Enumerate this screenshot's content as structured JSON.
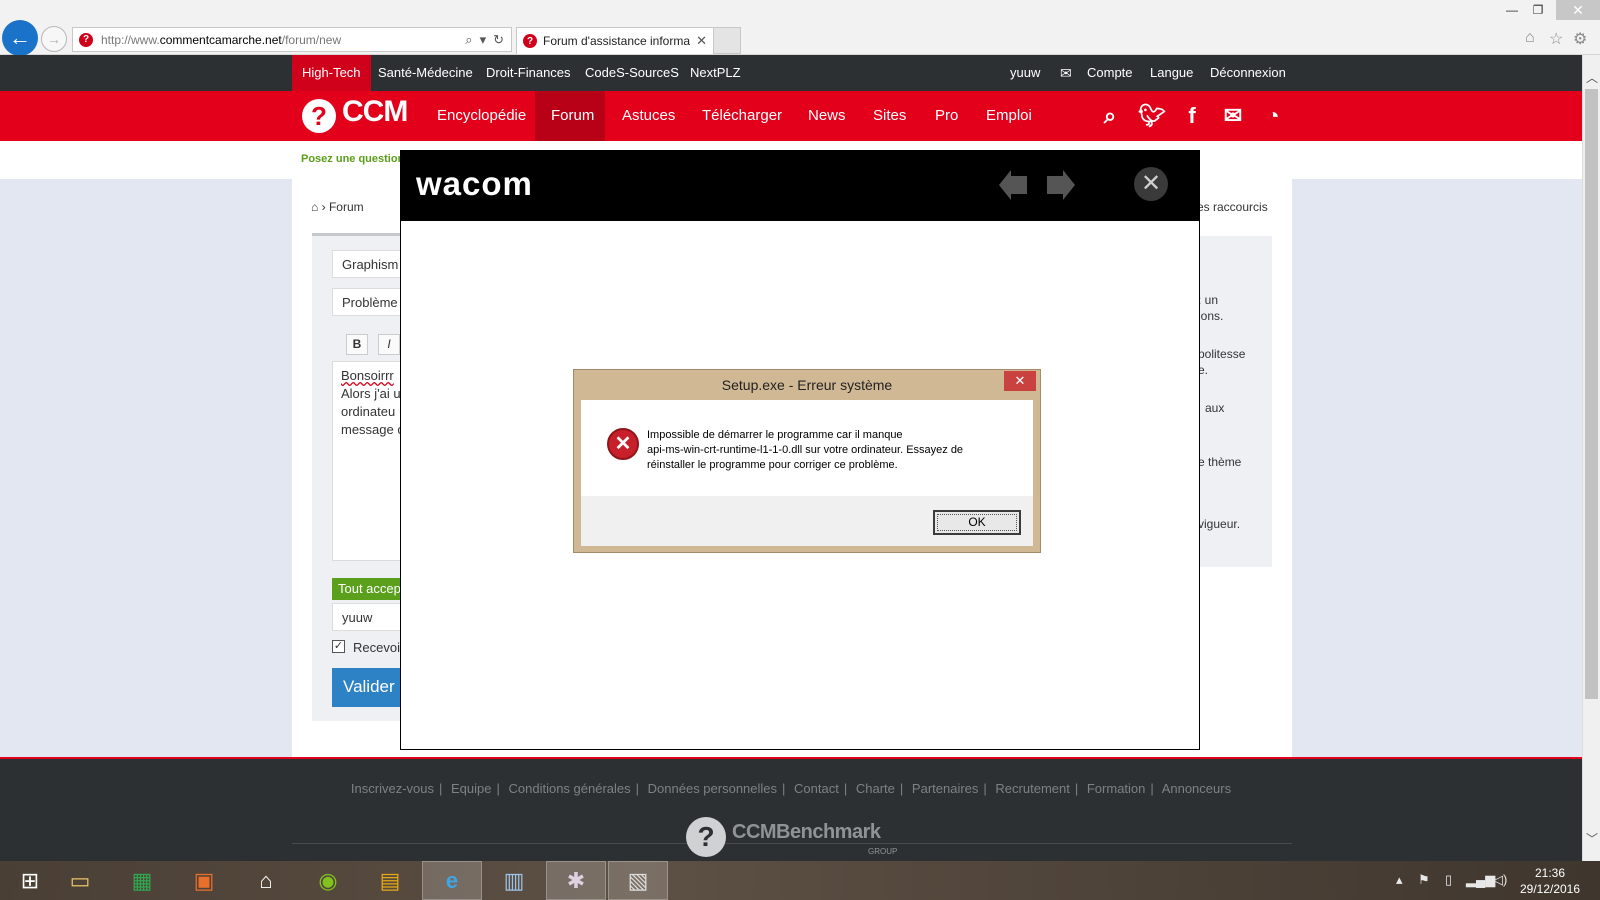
{
  "browser": {
    "url_prefix": "http://www.",
    "url_domain": "commentcamarche.net",
    "url_path": "/forum/new",
    "tab_title": "Forum d'assistance informa...",
    "icons": [
      "back-arrow-icon",
      "forward-arrow-icon",
      "search-icon",
      "refresh-icon",
      "home-icon",
      "star-icon",
      "gear-icon"
    ]
  },
  "topbar": {
    "sites": [
      "High-Tech",
      "Santé-Médecine",
      "Droit-Finances",
      "CodeS-SourceS",
      "NextPLZ"
    ],
    "user": "yuuw",
    "account": "Compte",
    "language": "Langue",
    "logout": "Déconnexion"
  },
  "mainnav": {
    "logo": "CCM",
    "items": [
      "Encyclopédie",
      "Forum",
      "Astuces",
      "Télécharger",
      "News",
      "Sites",
      "Pro",
      "Emploi"
    ],
    "active": "Forum"
  },
  "subnav": {
    "ask": "Posez une question"
  },
  "breadcrumb": {
    "label": "Forum",
    "separator": "›"
  },
  "shortcuts": "es raccourcis",
  "form": {
    "category": "Graphism",
    "title": "Problème",
    "bold": "B",
    "italic": "I",
    "body_lines": [
      "Bonsoirrr",
      "Alors j'ai u",
      "ordinateu",
      "message c"
    ],
    "accept": "Tout accep",
    "username": "yuuw",
    "receive": "Recevoi",
    "submit": "Valider"
  },
  "sidebar_fragments": [
    ": un",
    "ions.",
    "politesse",
    "e.",
    "aux",
    "e thème",
    "vigueur."
  ],
  "footer": {
    "links": [
      "Inscrivez-vous",
      "Equipe",
      "Conditions générales",
      "Données personnelles",
      "Contact",
      "Charte",
      "Partenaires",
      "Recrutement",
      "Formation",
      "Annonceurs"
    ],
    "brand": "CCMBenchmark",
    "brand_sub": "GROUP"
  },
  "wacom": {
    "logo": "wacom"
  },
  "error_dialog": {
    "title": "Setup.exe - Erreur système",
    "message_line1": "Impossible de démarrer le programme car il manque",
    "message_line2": "api-ms-win-crt-runtime-l1-1-0.dll sur votre ordinateur. Essayez de",
    "message_line3": "réinstaller le programme pour corriger ce problème.",
    "ok": "OK"
  },
  "taskbar": {
    "time": "21:36",
    "date": "29/12/2016"
  },
  "colors": {
    "brand_red": "#e2001a",
    "dark": "#2c3033",
    "accent_blue": "#1a73c8",
    "green": "#5aa01c"
  }
}
